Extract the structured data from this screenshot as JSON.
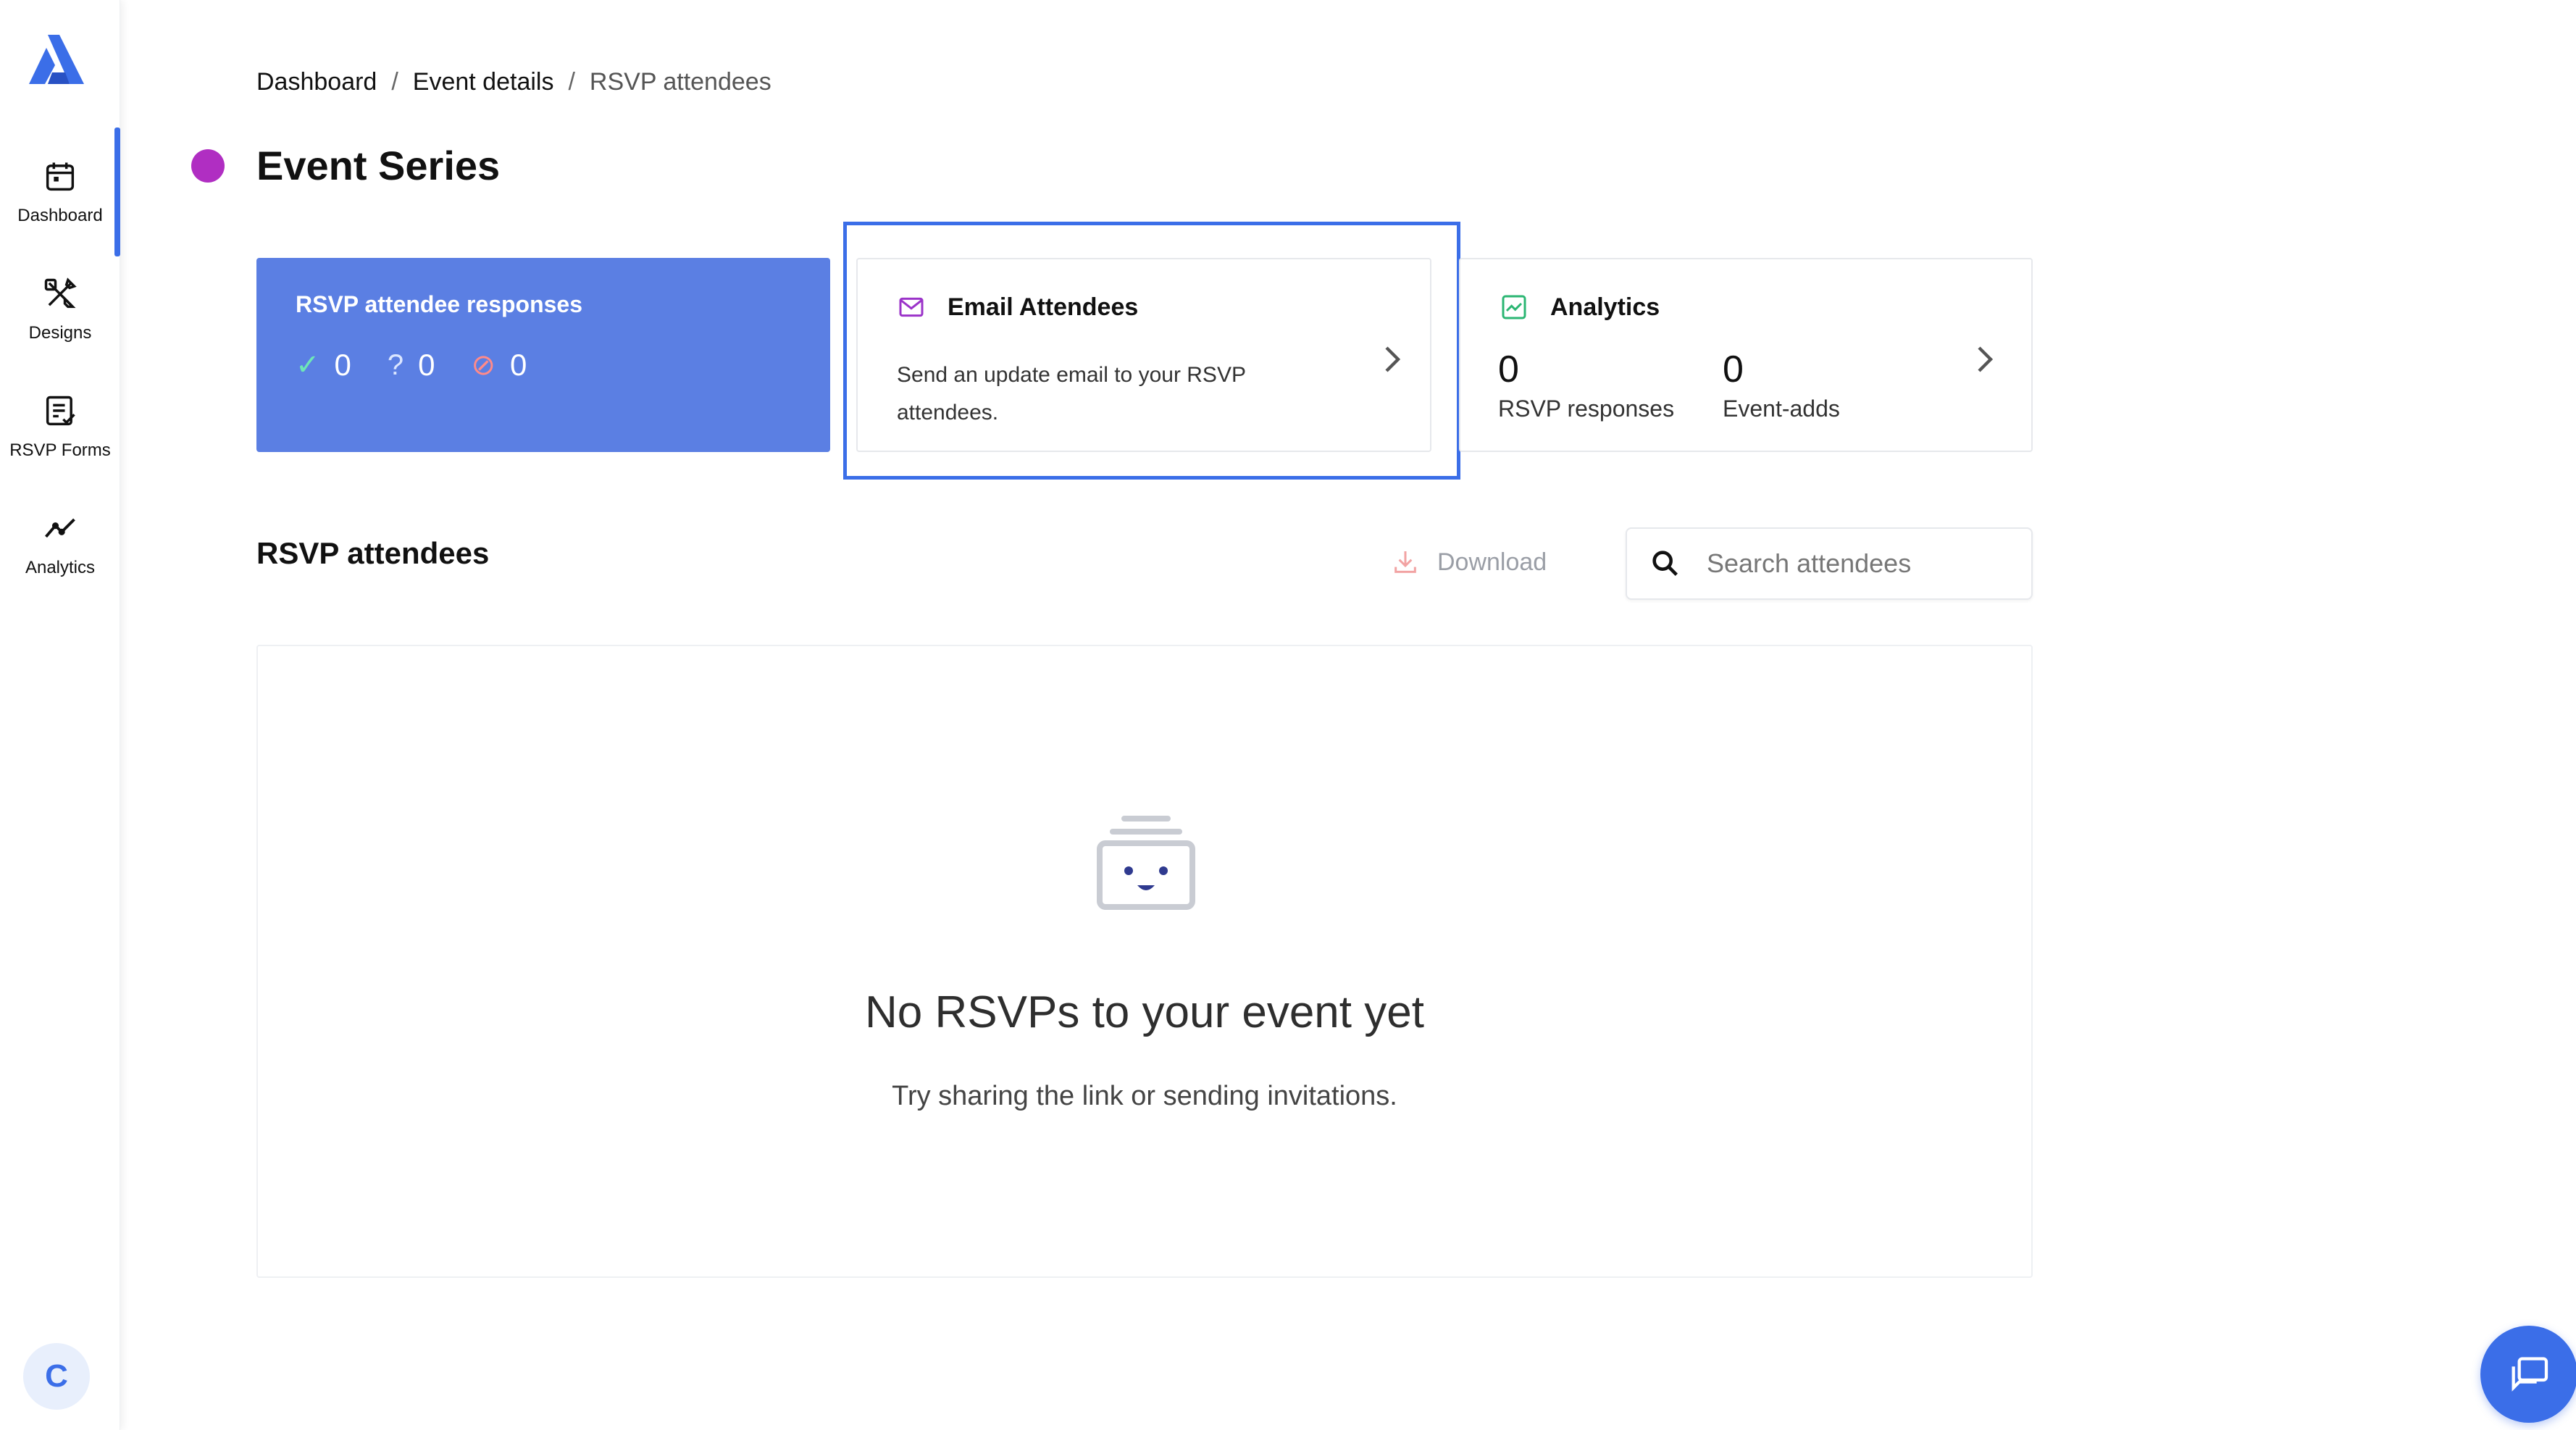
{
  "sidebar": {
    "items": [
      {
        "label": "Dashboard",
        "icon": "calendar-icon"
      },
      {
        "label": "Designs",
        "icon": "design-tools-icon"
      },
      {
        "label": "RSVP Forms",
        "icon": "form-checklist-icon"
      },
      {
        "label": "Analytics",
        "icon": "trend-line-icon"
      }
    ],
    "avatar_initial": "C"
  },
  "breadcrumb": {
    "items": [
      "Dashboard",
      "Event details",
      "RSVP attendees"
    ],
    "separator": "/"
  },
  "event": {
    "title": "Event Series",
    "color": "#b02ec2"
  },
  "summary_card": {
    "title": "RSVP attendee responses",
    "yes_count": "0",
    "maybe_count": "0",
    "no_count": "0",
    "color": "#5b7fe3"
  },
  "email_card": {
    "title": "Email Attendees",
    "description": "Send an update email to your RSVP attendees."
  },
  "analytics_card": {
    "title": "Analytics",
    "rsvp_responses_value": "0",
    "rsvp_responses_label": "RSVP responses",
    "event_adds_value": "0",
    "event_adds_label": "Event-adds"
  },
  "attendees_section": {
    "title": "RSVP attendees",
    "download_label": "Download",
    "search_placeholder": "Search attendees"
  },
  "empty_state": {
    "title": "No RSVPs to your event yet",
    "subtitle": "Try sharing the link or sending invitations."
  },
  "colors": {
    "accent": "#3b6ee8",
    "highlight_frame": "#3b6ee8"
  }
}
